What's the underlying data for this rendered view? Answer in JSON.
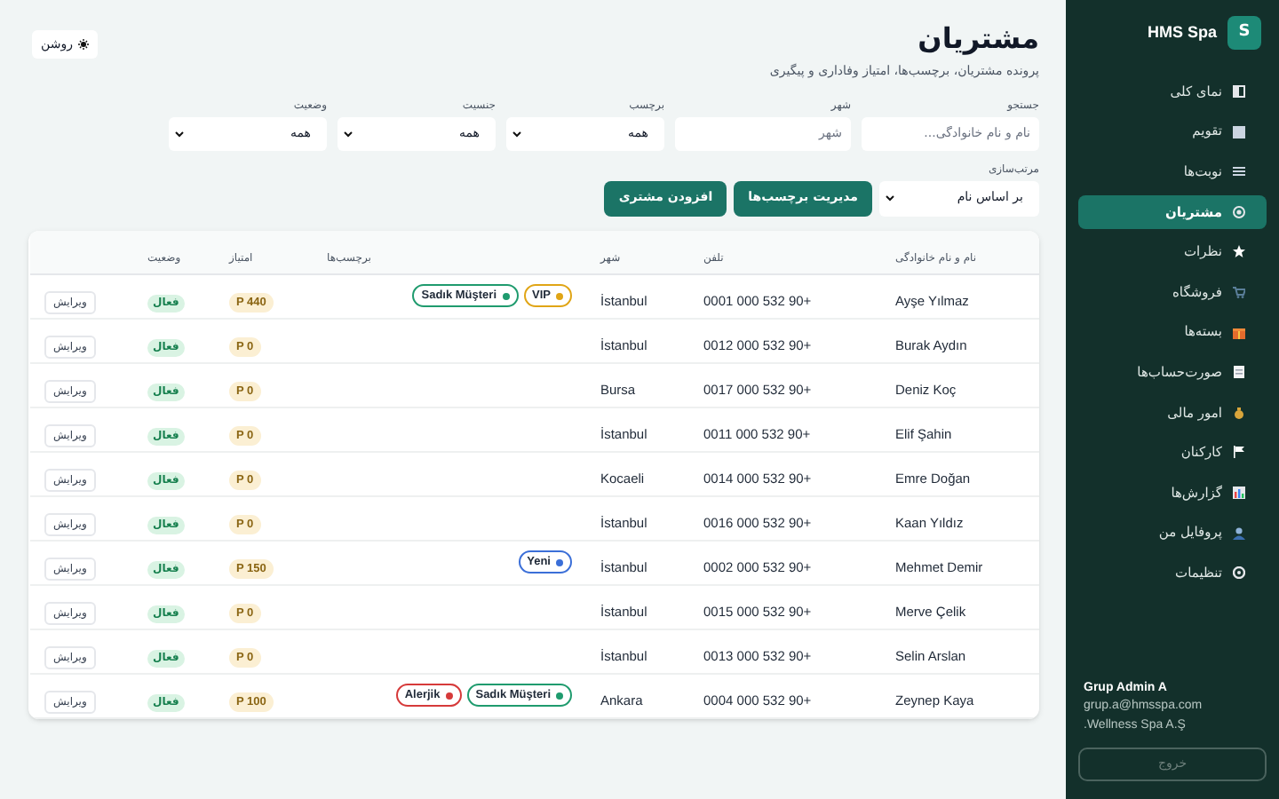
{
  "brand": {
    "logo": "S",
    "name": "HMS Spa"
  },
  "sidebar": {
    "items": [
      {
        "label": "نمای کلی",
        "selected": false
      },
      {
        "label": "تقویم",
        "selected": false
      },
      {
        "label": "نوبت‌ها",
        "selected": false
      },
      {
        "label": "مشتریان",
        "selected": true
      },
      {
        "label": "نظرات",
        "selected": false
      },
      {
        "label": "فروشگاه",
        "selected": false
      },
      {
        "label": "بسته‌ها",
        "selected": false
      },
      {
        "label": "صورت‌حساب‌ها",
        "selected": false
      },
      {
        "label": "امور مالی",
        "selected": false
      },
      {
        "label": "کارکنان",
        "selected": false
      },
      {
        "label": "گزارش‌ها",
        "selected": false
      },
      {
        "label": "پروفایل من",
        "selected": false
      },
      {
        "label": "تنظیمات",
        "selected": false
      }
    ]
  },
  "user": {
    "name": "Grup Admin A",
    "email": "grup.a@hmsspa.com",
    "company": ".Wellness Spa A.Ş"
  },
  "logout_button": "خروج",
  "page": {
    "title": "مشتریان",
    "subtitle": "پرونده مشتریان، برچسب‌ها، امتیاز وفاداری و پیگیری"
  },
  "theme_toggle": "روشن",
  "filters": [
    {
      "kind": "input",
      "label": "جستجو",
      "placeholder": "نام و نام خانوادگی..."
    },
    {
      "kind": "input",
      "label": "شهر",
      "placeholder": "شهر"
    },
    {
      "kind": "select",
      "label": "برچسب",
      "value": "همه"
    },
    {
      "kind": "select",
      "label": "جنسیت",
      "value": "همه"
    },
    {
      "kind": "select",
      "label": "وضعیت",
      "value": "همه"
    }
  ],
  "sort": {
    "label": "مرتب‌سازی",
    "value": "بر اساس نام"
  },
  "buttons": [
    "مدیریت برچسب‌ها",
    "افزودن مشتری"
  ],
  "table": {
    "columns": [
      "نام و نام خانوادگی",
      "تلفن",
      "شهر",
      "برچسب‌ها",
      "امتیاز",
      "وضعیت"
    ],
    "rows": [
      {
        "name": "Ayşe Yılmaz",
        "phone": "0001 000 532 90+",
        "city": "İstanbul",
        "tags": [
          {
            "label": "VIP",
            "color": "#e0a516"
          },
          {
            "label": "Sadık Müşteri",
            "color": "#1f9b6e"
          }
        ],
        "points": "P 440",
        "status": "فعال",
        "action": "ویرایش"
      },
      {
        "name": "Burak Aydın",
        "phone": "0012 000 532 90+",
        "city": "İstanbul",
        "tags": [],
        "points": "P 0",
        "status": "فعال",
        "action": "ویرایش"
      },
      {
        "name": "Deniz Koç",
        "phone": "0017 000 532 90+",
        "city": "Bursa",
        "tags": [],
        "points": "P 0",
        "status": "فعال",
        "action": "ویرایش"
      },
      {
        "name": "Elif Şahin",
        "phone": "0011 000 532 90+",
        "city": "İstanbul",
        "tags": [],
        "points": "P 0",
        "status": "فعال",
        "action": "ویرایش"
      },
      {
        "name": "Emre Doğan",
        "phone": "0014 000 532 90+",
        "city": "Kocaeli",
        "tags": [],
        "points": "P 0",
        "status": "فعال",
        "action": "ویرایش"
      },
      {
        "name": "Kaan Yıldız",
        "phone": "0016 000 532 90+",
        "city": "İstanbul",
        "tags": [],
        "points": "P 0",
        "status": "فعال",
        "action": "ویرایش"
      },
      {
        "name": "Mehmet Demir",
        "phone": "0002 000 532 90+",
        "city": "İstanbul",
        "tags": [
          {
            "label": "Yeni",
            "color": "#3b6fd8"
          }
        ],
        "points": "P 150",
        "status": "فعال",
        "action": "ویرایش"
      },
      {
        "name": "Merve Çelik",
        "phone": "0015 000 532 90+",
        "city": "İstanbul",
        "tags": [],
        "points": "P 0",
        "status": "فعال",
        "action": "ویرایش"
      },
      {
        "name": "Selin Arslan",
        "phone": "0013 000 532 90+",
        "city": "İstanbul",
        "tags": [],
        "points": "P 0",
        "status": "فعال",
        "action": "ویرایش"
      },
      {
        "name": "Zeynep Kaya",
        "phone": "0004 000 532 90+",
        "city": "Ankara",
        "tags": [
          {
            "label": "Sadık Müşteri",
            "color": "#1f9b6e"
          },
          {
            "label": "Alerjik",
            "color": "#d63a3a"
          }
        ],
        "points": "P 100",
        "status": "فعال",
        "action": "ویرایش"
      }
    ]
  }
}
